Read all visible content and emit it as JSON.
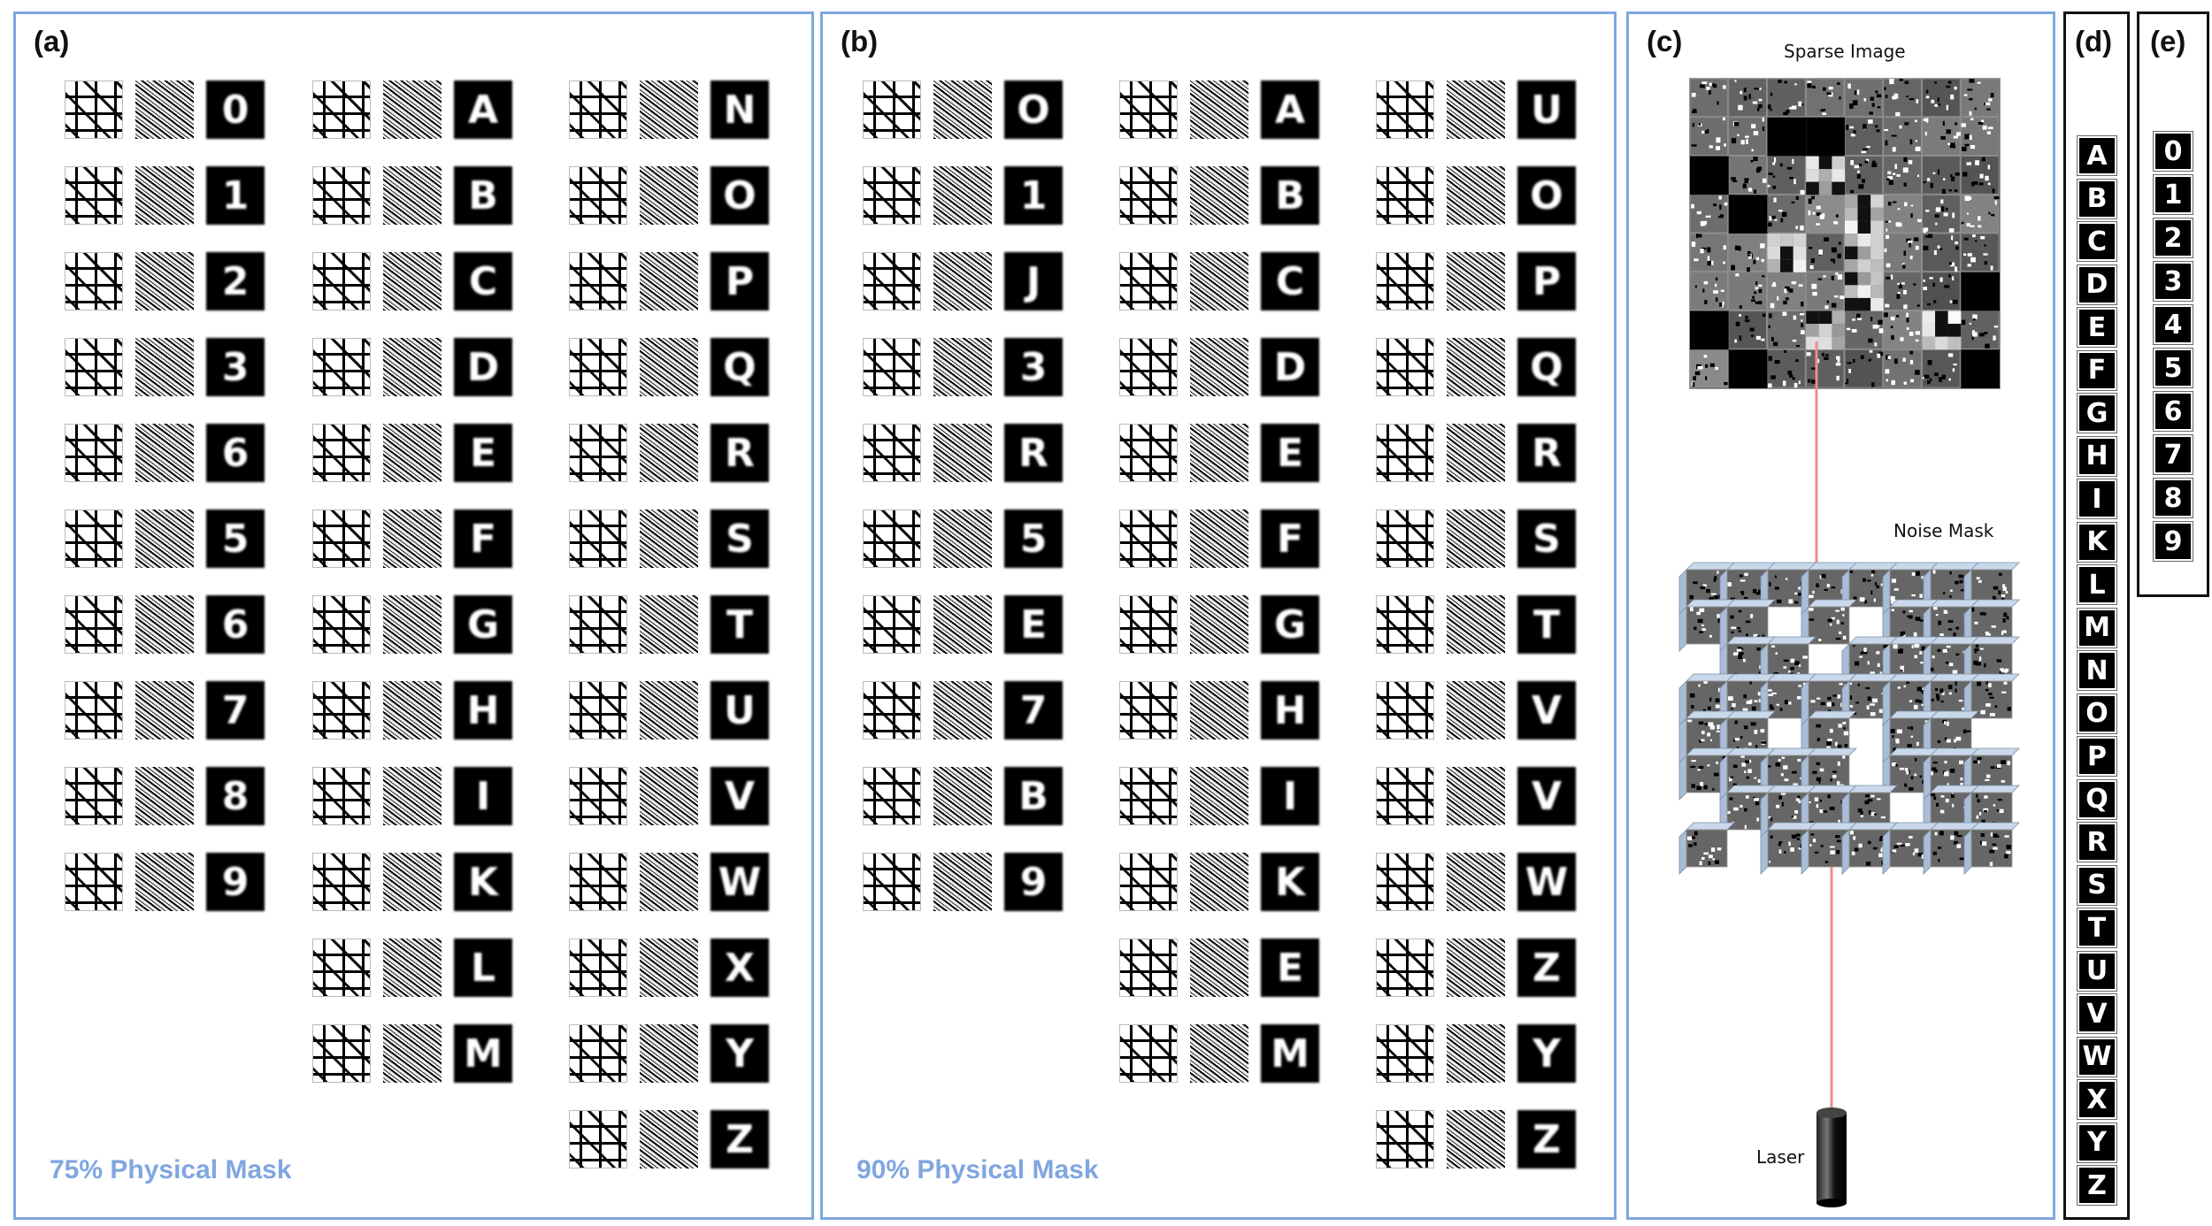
{
  "panels": {
    "a": {
      "label": "(a)",
      "caption": "75% Physical Mask"
    },
    "b": {
      "label": "(b)",
      "caption": "90% Physical Mask"
    },
    "c": {
      "label": "(c)",
      "sparse_image_label": "Sparse Image",
      "noise_mask_label": "Noise Mask",
      "laser_label": "Laser"
    },
    "d": {
      "label": "(d)"
    },
    "e": {
      "label": "(e)"
    }
  },
  "grid_a": {
    "columns": [
      [
        "0",
        "1",
        "2",
        "3",
        "6",
        "5",
        "6",
        "7",
        "8",
        "9"
      ],
      [
        "A",
        "B",
        "C",
        "D",
        "E",
        "F",
        "G",
        "H",
        "I",
        "K",
        "L",
        "M"
      ],
      [
        "N",
        "O",
        "P",
        "Q",
        "R",
        "S",
        "T",
        "U",
        "V",
        "W",
        "X",
        "Y",
        "Z"
      ]
    ]
  },
  "grid_b": {
    "columns": [
      [
        "O",
        "1",
        "J",
        "3",
        "R",
        "5",
        "E",
        "7",
        "B",
        "9"
      ],
      [
        "A",
        "B",
        "C",
        "D",
        "E",
        "F",
        "G",
        "H",
        "I",
        "K",
        "E",
        "M"
      ],
      [
        "U",
        "O",
        "P",
        "Q",
        "R",
        "S",
        "T",
        "V",
        "V",
        "W",
        "Z",
        "Y",
        "Z"
      ]
    ]
  },
  "column_d": [
    "A",
    "B",
    "C",
    "D",
    "E",
    "F",
    "G",
    "H",
    "I",
    "K",
    "L",
    "M",
    "N",
    "O",
    "P",
    "Q",
    "R",
    "S",
    "T",
    "U",
    "V",
    "W",
    "X",
    "Y",
    "Z"
  ],
  "column_e": [
    "0",
    "1",
    "2",
    "3",
    "4",
    "5",
    "6",
    "7",
    "8",
    "9"
  ],
  "colors": {
    "panel_border": "#7fa6e0",
    "laser_beam": "#f28b8b",
    "caption": "#7fa6e0"
  }
}
